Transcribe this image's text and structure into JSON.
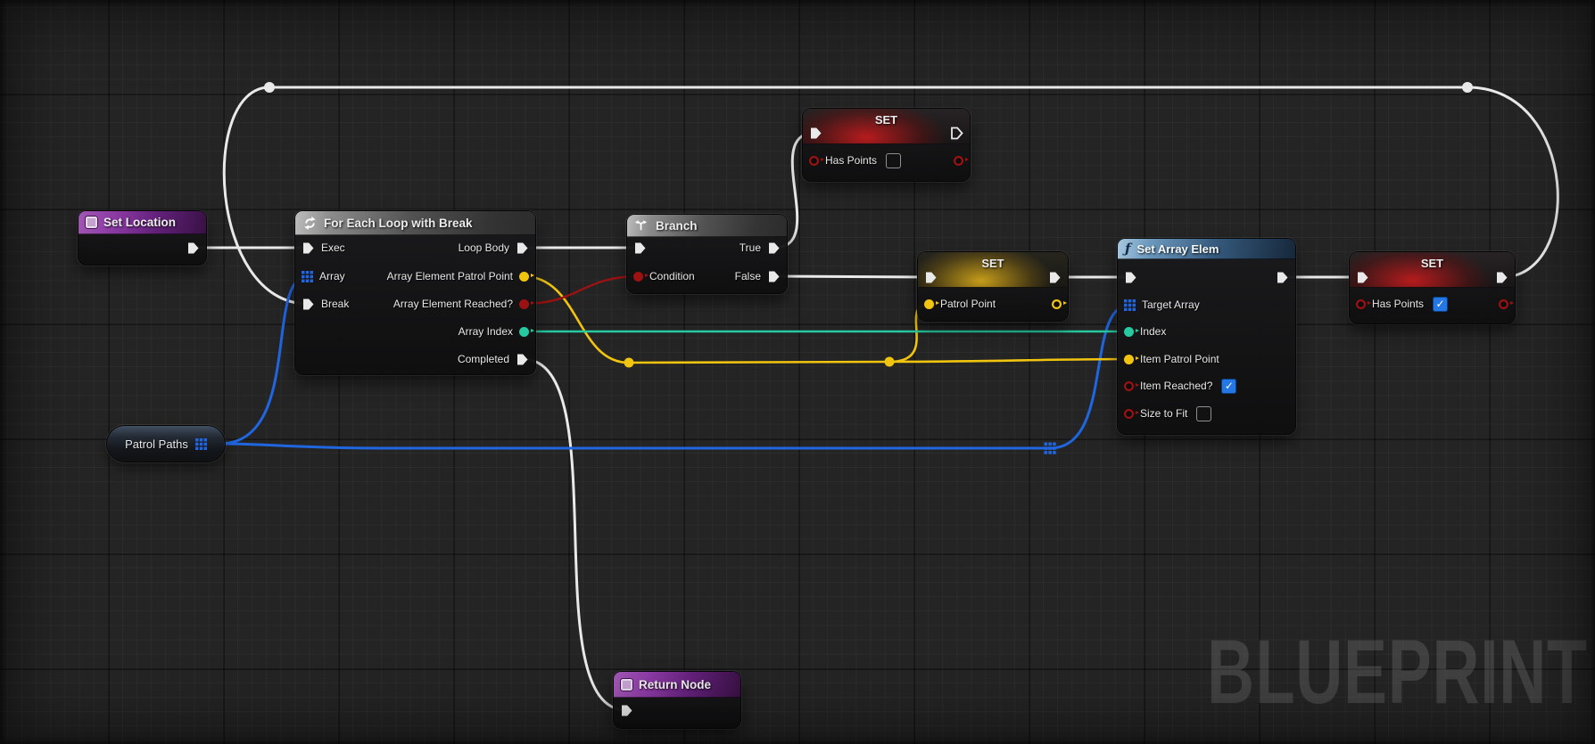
{
  "watermark": "BLUEPRINT",
  "colors": {
    "exec": "#e9e9e9",
    "array": "#2066e0",
    "int": "#27c9a1",
    "yellow": "#f1c40f",
    "bool": "#9c1212",
    "checkbox": "#2577e6"
  },
  "nodes": {
    "set_location": {
      "title": "Set Location"
    },
    "for_each": {
      "title": "For Each Loop with Break",
      "pin_exec": "Exec",
      "pin_array": "Array",
      "pin_break": "Break",
      "pin_loop_body": "Loop Body",
      "pin_array_element": "Array Element Patrol Point",
      "pin_array_reached": "Array Element Reached?",
      "pin_array_index": "Array Index",
      "pin_completed": "Completed"
    },
    "branch": {
      "title": "Branch",
      "pin_condition": "Condition",
      "pin_true": "True",
      "pin_false": "False"
    },
    "set_has_points_top": {
      "title": "SET",
      "pin_var": "Has Points",
      "value": false
    },
    "set_patrol_point": {
      "title": "SET",
      "pin_var": "Patrol Point"
    },
    "set_array_elem": {
      "title": "Set Array Elem",
      "pin_target_array": "Target Array",
      "pin_index": "Index",
      "pin_item": "Item Patrol Point",
      "pin_item_reached": "Item Reached?",
      "item_reached_value": true,
      "pin_size_to_fit": "Size to Fit",
      "size_to_fit_value": false
    },
    "set_has_points_right": {
      "title": "SET",
      "pin_var": "Has Points",
      "value": true
    },
    "patrol_paths": {
      "title": "Patrol Paths"
    },
    "return_node": {
      "title": "Return Node"
    }
  },
  "wires": [
    {
      "from": "Set Location (exec out)",
      "to": "For Each Loop with Break (Exec)",
      "type": "exec"
    },
    {
      "from": "For Each Loop with Break (Loop Body)",
      "to": "Branch (exec in)",
      "type": "exec"
    },
    {
      "from": "Branch (True)",
      "to": "SET Has Points top (exec in)",
      "type": "exec"
    },
    {
      "from": "Branch (False)",
      "to": "SET Patrol Point (exec in)",
      "type": "exec"
    },
    {
      "from": "SET Patrol Point (exec out)",
      "to": "Set Array Elem (exec in)",
      "type": "exec"
    },
    {
      "from": "Set Array Elem (exec out)",
      "to": "SET Has Points right (exec in)",
      "type": "exec"
    },
    {
      "from": "SET Has Points right (exec out)",
      "to": "For Each Loop with Break (Break)",
      "type": "exec"
    },
    {
      "from": "For Each Loop with Break (Completed)",
      "to": "Return Node (exec in)",
      "type": "exec"
    },
    {
      "from": "Patrol Paths",
      "to": "For Each Loop with Break (Array)",
      "type": "array"
    },
    {
      "from": "Patrol Paths",
      "to": "Set Array Elem (Target Array)",
      "type": "array"
    },
    {
      "from": "For Each Loop with Break (Array Element Patrol Point)",
      "to": "SET Patrol Point (Patrol Point)",
      "type": "object"
    },
    {
      "from": "For Each Loop with Break (Array Element Patrol Point)",
      "to": "Set Array Elem (Item Patrol Point)",
      "type": "object"
    },
    {
      "from": "For Each Loop with Break (Array Element Reached?)",
      "to": "Branch (Condition)",
      "type": "bool"
    },
    {
      "from": "For Each Loop with Break (Array Index)",
      "to": "Set Array Elem (Index)",
      "type": "int"
    }
  ]
}
